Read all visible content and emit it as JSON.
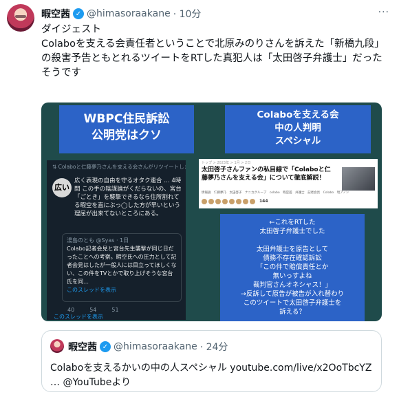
{
  "tweet": {
    "display_name": "暇空茜",
    "handle": "@himasoraakane",
    "time": "· 10分",
    "more": "···",
    "lines": [
      "ダイジェスト",
      "Colaboを支える会責任者ということで北原みのりさんを訴えた「新橋九段」",
      "の殺害予告ともとれるツイートをRTした真犯人は「太田啓子弁護士」だった",
      "そうです"
    ]
  },
  "media": {
    "left_title": [
      "WBPC住民訴訟",
      "公明党はクソ"
    ],
    "right_title": [
      "Colaboを支える会",
      "中の人判明",
      "スペシャル"
    ],
    "rt_panel": {
      "retweet_line": "⇅ Colaboと仁藤夢乃さんを支える会さんがリツイートしました",
      "badge": "広い",
      "text": "広く表現の自由を守るオタク連合 … 4時間 この手の陰謀論がくだらないの、宮台「ごとき」を襲撃できるなら住所割れてる暇空を直にぶっ◯した方が早いという理屈が出来てないところにある。",
      "quote_header": "湯島のとも @Syas · 1日",
      "quote_text": "Colabo記者会見と宮台先生襲撃が同じ日だったことへの考察。暇空氏への圧力として記者会見はしたが一般人には目立ってほしくない、この件をTVとかで取り上げそうな宮台氏を同…",
      "quote_link": "このスレッドを表示",
      "actions": [
        "40",
        "54",
        "51"
      ],
      "thread": "このスレッドを表示"
    },
    "article": {
      "top": "トップ > 2023年 > 1月 > 2日",
      "title": "太田啓子さんファンの私目線で「Colaboと仁藤夢乃さんを支える会」について徹底解説！",
      "tags": "情報論　仁藤夢乃　太田啓子　ナニカグループ　colabo　暇空茜　弁護士　記者会見　Colabo　現アノン",
      "count": "144"
    },
    "note_lines": [
      "←これをRTした",
      "太田啓子弁護士でした",
      "",
      "太田弁護士を原告として",
      "債務不存在確認訴訟",
      "「この件で賠償責任とか",
      "無いっすよね",
      "裁判官さんオネシャス！」",
      "→反訴して原告が被告が入れ替わり",
      "このツイートで太田啓子弁護士を",
      "訴える？"
    ]
  },
  "quote": {
    "display_name": "暇空茜",
    "handle": "@himasoraakane",
    "time": "· 24分",
    "lines": [
      "Colaboを支えるかいの中の人スペシャル youtube.com/live/x2OoTbcYZ",
      "… @YouTubeより"
    ]
  }
}
